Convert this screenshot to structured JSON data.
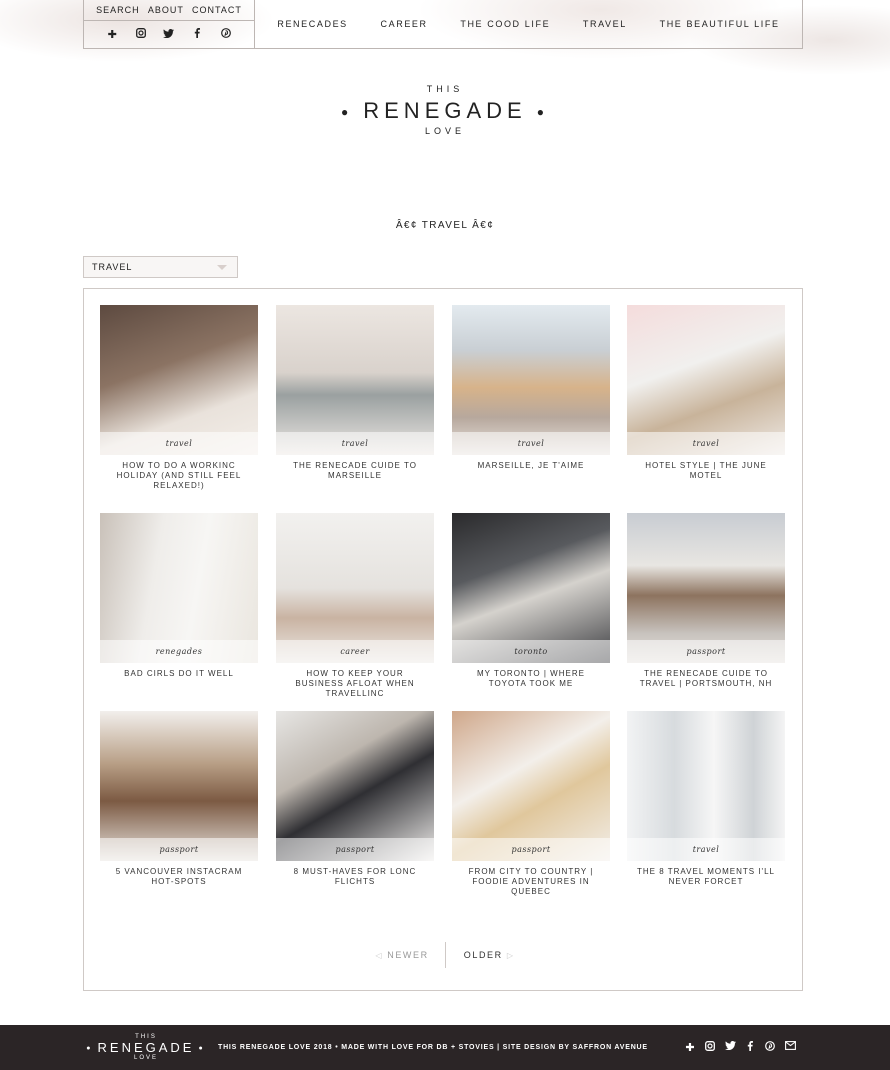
{
  "util_links": [
    "SEARCH",
    "ABOUT",
    "CONTACT"
  ],
  "social_icons": [
    "plus-icon",
    "instagram-icon",
    "twitter-icon",
    "facebook-icon",
    "pinterest-icon"
  ],
  "main_nav": [
    "RENECADES",
    "CAREER",
    "THE COOD LIFE",
    "TRAVEL",
    "THE BEAUTIFUL LIFE"
  ],
  "logo": {
    "top": "THIS",
    "main": "RENEGADE",
    "bottom": "LOVE"
  },
  "section_title": "Â€¢ TRAVEL Â€¢",
  "category_select": {
    "value": "TRAVEL"
  },
  "posts": [
    {
      "tag": "travel",
      "title": "HOW TO DO A WORKINC HOLIDAY (AND STILL FEEL RELAXED!)"
    },
    {
      "tag": "travel",
      "title": "THE RENECADE CUIDE TO MARSEILLE"
    },
    {
      "tag": "travel",
      "title": "MARSEILLE, JE T'AIME"
    },
    {
      "tag": "travel",
      "title": "HOTEL STYLE | THE JUNE MOTEL"
    },
    {
      "tag": "renegades",
      "title": "BAD CIRLS DO IT WELL"
    },
    {
      "tag": "career",
      "title": "HOW TO KEEP YOUR BUSINESS AFLOAT WHEN TRAVELLINC"
    },
    {
      "tag": "toronto",
      "title": "MY TORONTO | WHERE TOYOTA TOOK ME"
    },
    {
      "tag": "passport",
      "title": "THE RENECADE CUIDE TO TRAVEL | PORTSMOUTH, NH"
    },
    {
      "tag": "passport",
      "title": "5 VANCOUVER INSTACRAM HOT-SPOTS"
    },
    {
      "tag": "passport",
      "title": "8 MUST-HAVES FOR LONC FLICHTS"
    },
    {
      "tag": "passport",
      "title": "FROM CITY TO COUNTRY | FOODIE ADVENTURES IN QUEBEC"
    },
    {
      "tag": "travel",
      "title": "THE 8 TRAVEL MOMENTS I'LL NEVER FORCET"
    }
  ],
  "pager": {
    "newer": "NEWER",
    "older": "OLDER"
  },
  "footer": {
    "logo_top": "THIS",
    "logo_main": "RENEGADE",
    "logo_bottom": "LOVE",
    "text": "THIS RENEGADE LOVE 2018 • MADE WITH LOVE FOR DB + STOVIES | SITE DESIGN BY SAFFRON AVENUE",
    "icons": [
      "plus-icon",
      "instagram-icon",
      "twitter-icon",
      "facebook-icon",
      "pinterest-icon",
      "email-icon"
    ]
  }
}
